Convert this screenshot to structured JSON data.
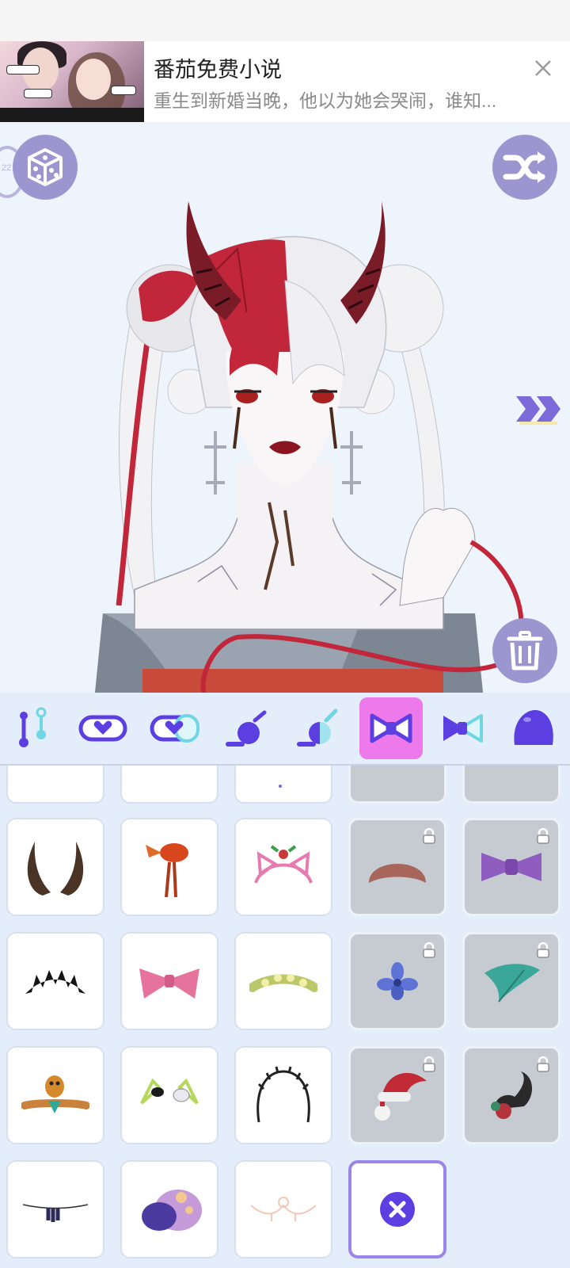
{
  "ad": {
    "title": "番茄免费小说",
    "subtitle": "重生到新婚当晚，他以为她会哭闹，谁知...",
    "close_icon": "close-icon"
  },
  "canvas": {
    "level_text": "22",
    "left_button_icon": "dice-icon",
    "right_button_icon": "shuffle-icon",
    "next_icon": "double-chevron-right-icon",
    "delete_icon": "trash-icon"
  },
  "categories": [
    {
      "name": "body-pose"
    },
    {
      "name": "eyes-heart"
    },
    {
      "name": "eyes-heart-half"
    },
    {
      "name": "accessory-dot"
    },
    {
      "name": "accessory-half"
    },
    {
      "name": "hair-bow",
      "active": true
    },
    {
      "name": "hair-bow-half"
    },
    {
      "name": "blob"
    }
  ],
  "items": [
    {
      "icon": "horns-icon",
      "locked": false
    },
    {
      "icon": "goldfish-hairpin-icon",
      "locked": false
    },
    {
      "icon": "cat-ear-headband-icon",
      "locked": false
    },
    {
      "icon": "croissant-hat-icon",
      "locked": true
    },
    {
      "icon": "purple-bow-icon",
      "locked": true
    },
    {
      "icon": "black-tiara-icon",
      "locked": false
    },
    {
      "icon": "pink-bow-icon",
      "locked": false
    },
    {
      "icon": "flower-crown-icon",
      "locked": false
    },
    {
      "icon": "blue-flower-icon",
      "locked": true
    },
    {
      "icon": "green-leaf-icon",
      "locked": true
    },
    {
      "icon": "snake-headpiece-icon",
      "locked": false
    },
    {
      "icon": "ear-clips-icon",
      "locked": false
    },
    {
      "icon": "thorn-headband-icon",
      "locked": false
    },
    {
      "icon": "santa-hat-icon",
      "locked": true
    },
    {
      "icon": "scorpion-icon",
      "locked": true
    },
    {
      "icon": "bead-chain-icon",
      "locked": false
    },
    {
      "icon": "purple-mushroom-icon",
      "locked": false
    },
    {
      "icon": "pearl-chain-icon",
      "locked": false
    },
    {
      "icon": "remove-item-icon",
      "locked": false,
      "selected": true
    }
  ],
  "colors": {
    "accent": "#5b3fe0",
    "active_tab": "#ee79ea",
    "button": "#9b96cf",
    "tile_border_selected": "#9a85ea",
    "hair_red": "#c2263a"
  }
}
